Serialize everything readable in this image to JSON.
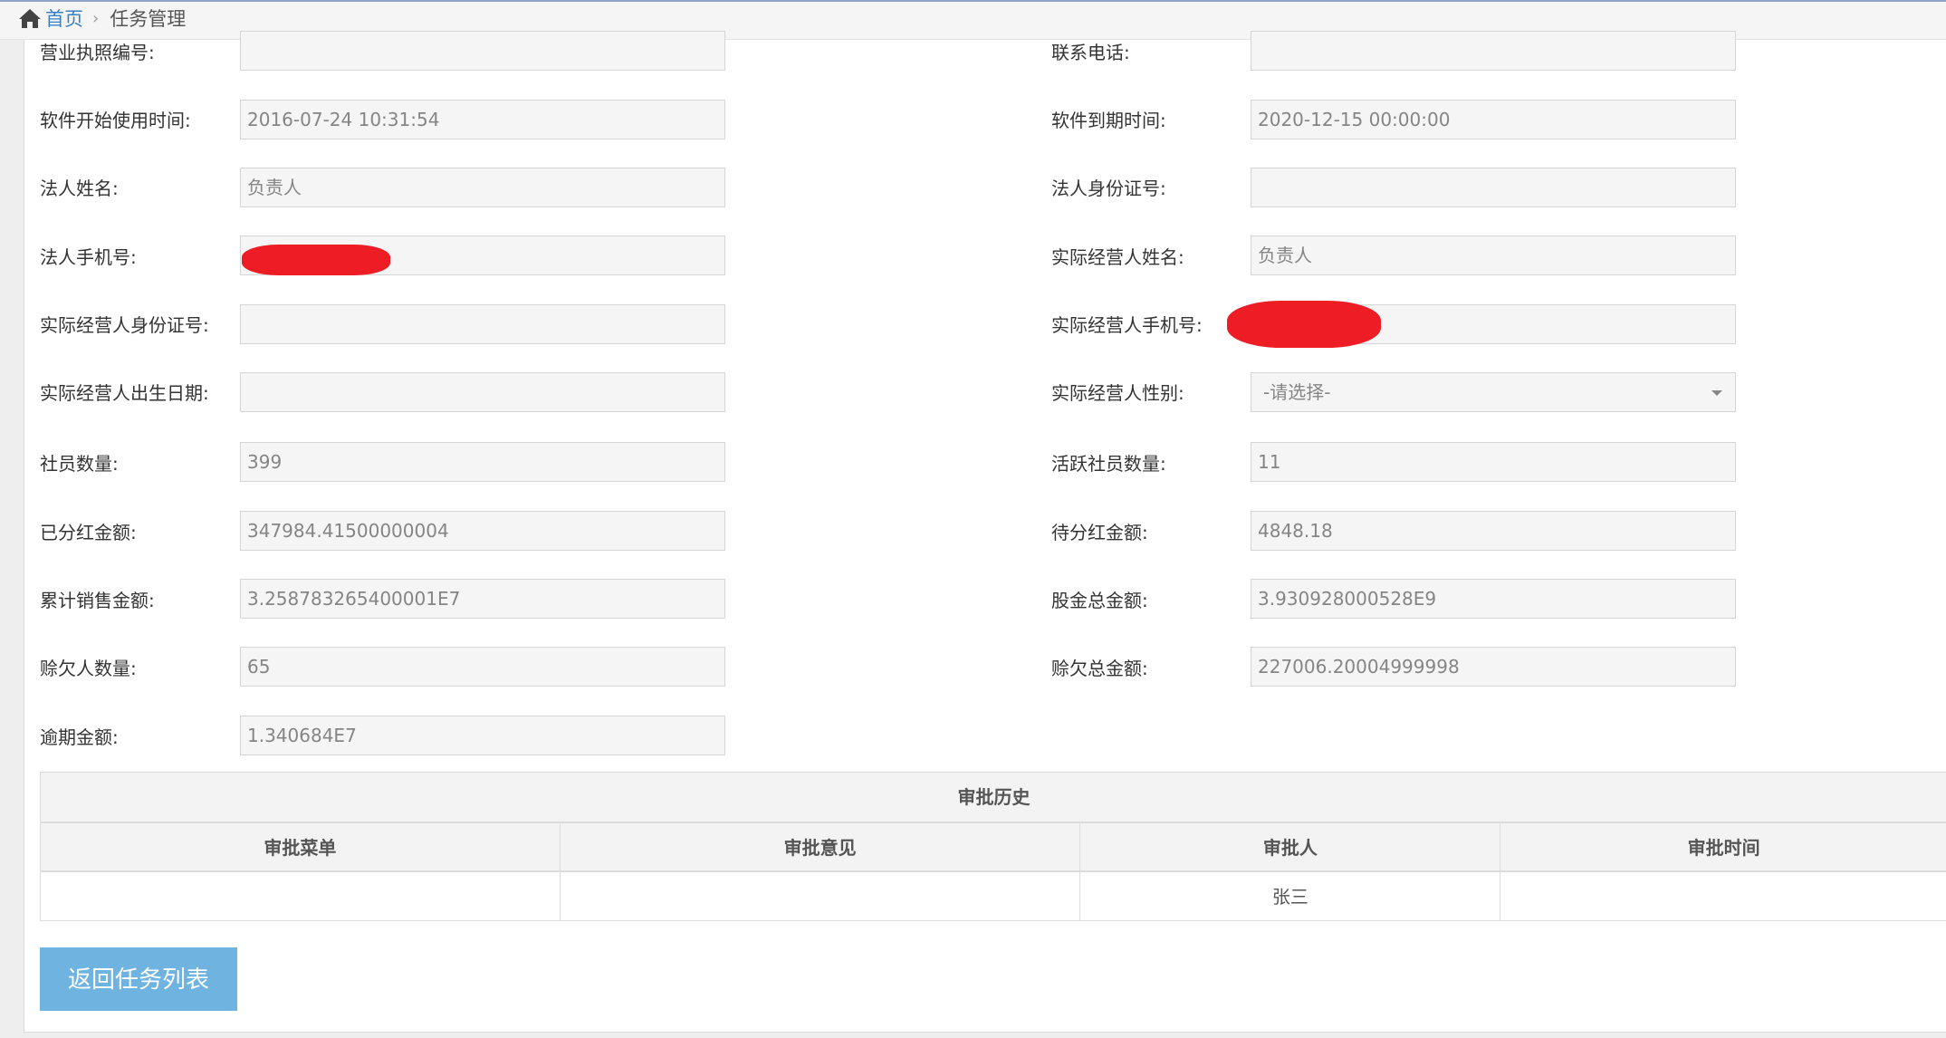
{
  "breadcrumb": {
    "home": "首页",
    "separator": "›",
    "current": "任务管理",
    "home_icon": "home-icon"
  },
  "form": {
    "business_license_no": {
      "label": "营业执照编号:",
      "value": ""
    },
    "contact_phone": {
      "label": "联系电话:",
      "value": ""
    },
    "software_start_time": {
      "label": "软件开始使用时间:",
      "value": "2016-07-24 10:31:54"
    },
    "software_expire_time": {
      "label": "软件到期时间:",
      "value": "2020-12-15 00:00:00"
    },
    "legal_person_name": {
      "label": "法人姓名:",
      "value": "负责人"
    },
    "legal_person_id": {
      "label": "法人身份证号:",
      "value": ""
    },
    "legal_person_phone": {
      "label": "法人手机号:",
      "value": ""
    },
    "operator_name": {
      "label": "实际经营人姓名:",
      "value": "负责人"
    },
    "operator_id": {
      "label": "实际经营人身份证号:",
      "value": ""
    },
    "operator_phone": {
      "label": "实际经营人手机号:",
      "value": ""
    },
    "operator_birth": {
      "label": "实际经营人出生日期:",
      "value": ""
    },
    "operator_gender": {
      "label": "实际经营人性别:",
      "value": "-请选择-"
    },
    "member_count": {
      "label": "社员数量:",
      "value": "399"
    },
    "active_member_count": {
      "label": "活跃社员数量:",
      "value": "11"
    },
    "dividend_paid": {
      "label": "已分红金额:",
      "value": "347984.41500000004"
    },
    "dividend_pending": {
      "label": "待分红金额:",
      "value": "4848.18"
    },
    "total_sales": {
      "label": "累计销售金额:",
      "value": "3.258783265400001E7"
    },
    "total_shares": {
      "label": "股金总金额:",
      "value": "3.930928000528E9"
    },
    "debtor_count": {
      "label": "赊欠人数量:",
      "value": "65"
    },
    "debt_total": {
      "label": "赊欠总金额:",
      "value": "227006.20004999998"
    },
    "overdue_amount": {
      "label": "逾期金额:",
      "value": "1.340684E7"
    }
  },
  "history": {
    "title": "审批历史",
    "columns": [
      "审批菜单",
      "审批意见",
      "审批人",
      "审批时间"
    ],
    "rows": [
      [
        "",
        "",
        "张三",
        ""
      ]
    ]
  },
  "buttons": {
    "back": "返回任务列表"
  },
  "colors": {
    "redaction": "#ee1c25",
    "button": "#6fb3e0",
    "link": "#3a81c4"
  }
}
